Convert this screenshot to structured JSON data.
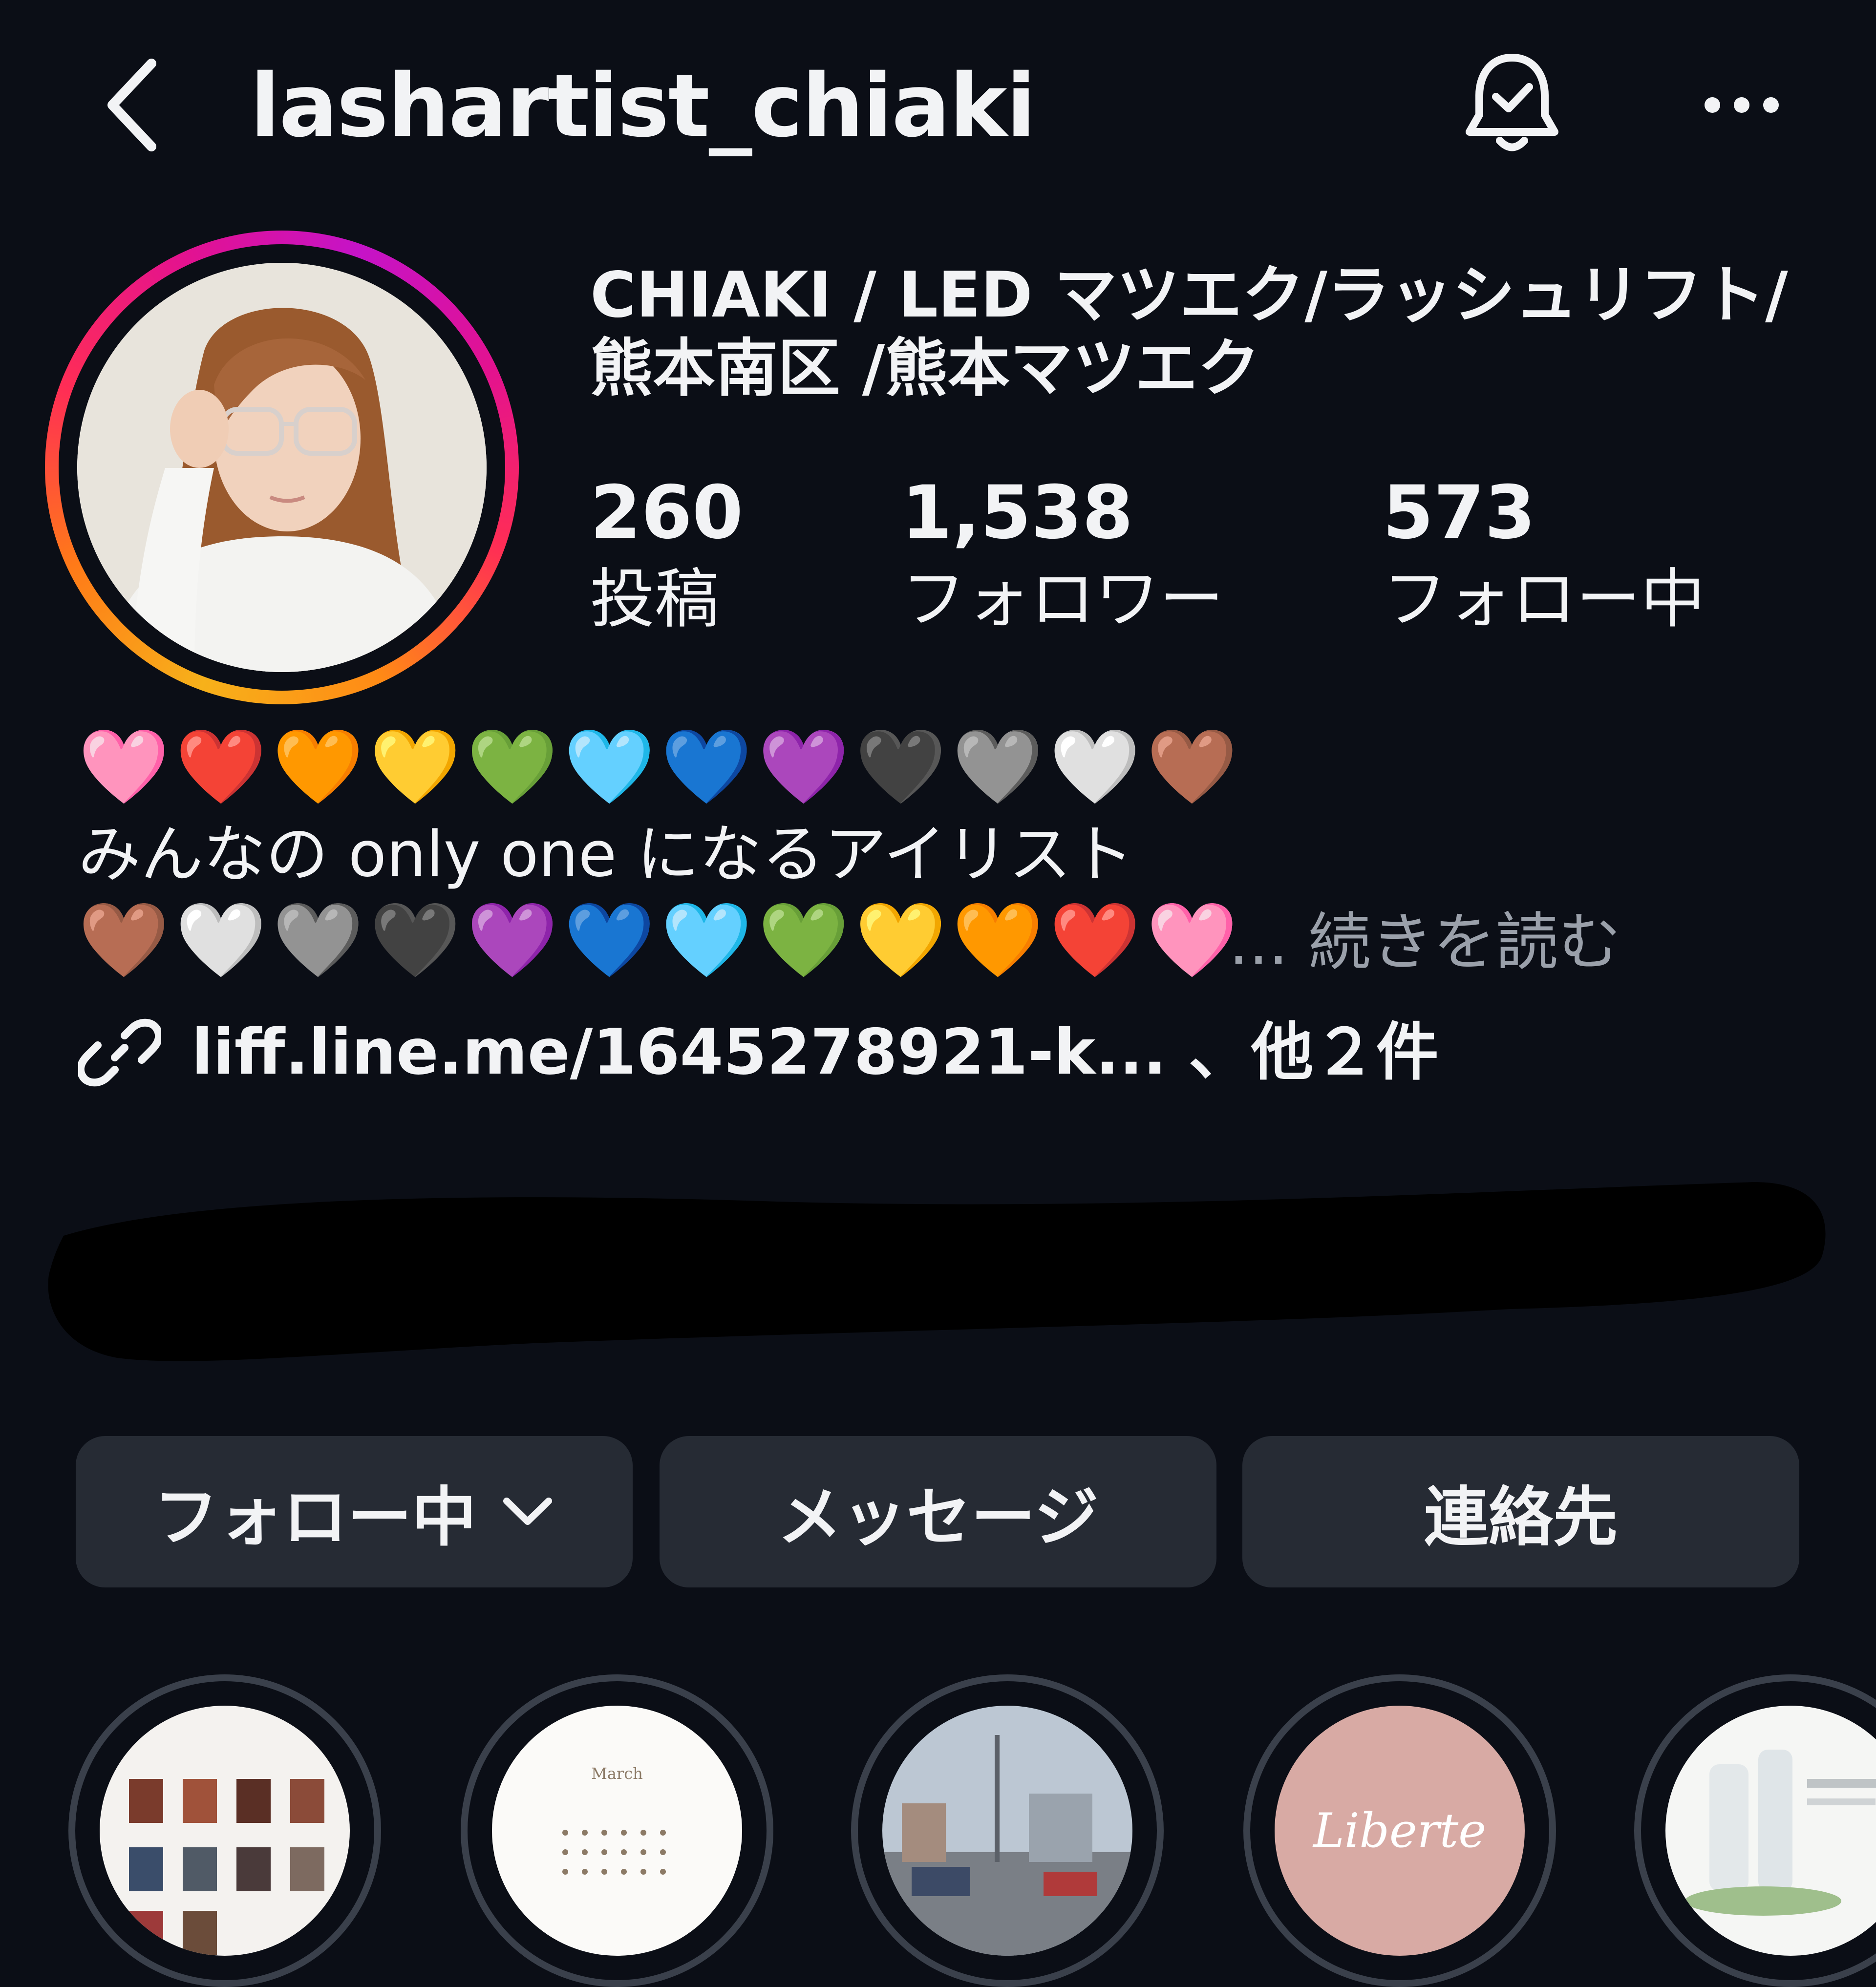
{
  "header": {
    "username": "lashartist_chiaki",
    "back_icon": "chevron-left-icon",
    "bell_icon": "bell-check-icon",
    "more_icon": "ellipsis-icon"
  },
  "profile": {
    "full_name_line1": "CHIAKI / LED マツエク/ラッシュリフト/",
    "full_name_line2": "熊本南区 /熊本マツエク",
    "stats": {
      "posts": {
        "value": "260",
        "label": "投稿"
      },
      "followers": {
        "value": "1,538",
        "label": "フォロワー"
      },
      "following": {
        "value": "573",
        "label": "フォロー中"
      }
    }
  },
  "bio": {
    "hearts_line1": "🩷❤️🧡💛💚🩵💙💜🖤🩶🤍🤎",
    "text": "みんなの only one になるアイリスト",
    "hearts_line2": "🤎🤍🩶🖤💜💙🩵💚💛🧡❤️🩷",
    "read_more": "... 続きを読む",
    "link_text": "liff.line.me/1645278921-k... 、他２件",
    "link_icon": "link-icon"
  },
  "buttons": {
    "following": "フォロー中",
    "message": "メッセージ",
    "contact": "連絡先"
  },
  "highlights": {
    "calendar_month": "March",
    "brand_text": "Liberte"
  },
  "colors": {
    "background": "#0b0e16",
    "button": "#262b34",
    "ring_start": "#f7b11a",
    "ring_end": "#c513c8"
  }
}
